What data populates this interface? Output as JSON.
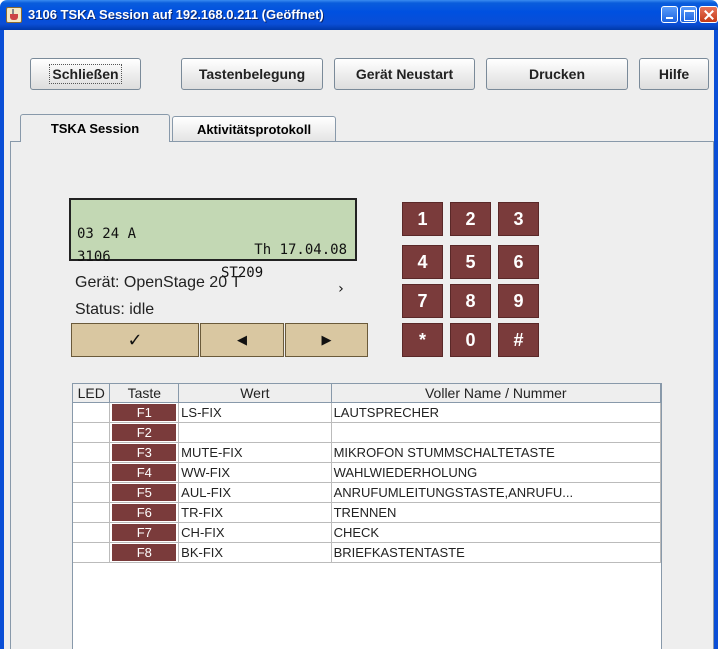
{
  "window": {
    "title": "3106 TSKA Session auf 192.168.0.211 (Geöffnet)"
  },
  "toolbar": {
    "close_label": "Schließen",
    "keymap_label": "Tastenbelegung",
    "restart_label": "Gerät Neustart",
    "print_label": "Drucken",
    "help_label": "Hilfe"
  },
  "tabs": [
    {
      "label": "TSKA Session",
      "active": true
    },
    {
      "label": "Aktivitätsprotokoll",
      "active": false
    }
  ],
  "display": {
    "line1_left": "03 24 A",
    "line1_right": "Th 17.04.08",
    "line2_left": "3106",
    "line2_mid": "ST209",
    "line2_right": "›"
  },
  "device": {
    "model_text": "Gerät: OpenStage 20 T",
    "status_text": "Status: idle"
  },
  "nav": {
    "ok_glyph": "✓",
    "left_glyph": "◀",
    "right_glyph": "▶"
  },
  "keypad": [
    "1",
    "2",
    "3",
    "4",
    "5",
    "6",
    "7",
    "8",
    "9",
    "*",
    "0",
    "#"
  ],
  "table": {
    "headers": [
      "LED",
      "Taste",
      "Wert",
      "Voller Name / Nummer"
    ],
    "rows": [
      {
        "key": "F1",
        "value": "LS-FIX",
        "name": "LAUTSPRECHER"
      },
      {
        "key": "F2",
        "value": "",
        "name": ""
      },
      {
        "key": "F3",
        "value": "MUTE-FIX",
        "name": "MIKROFON STUMMSCHALTETASTE"
      },
      {
        "key": "F4",
        "value": "WW-FIX",
        "name": "WAHLWIEDERHOLUNG"
      },
      {
        "key": "F5",
        "value": "AUL-FIX",
        "name": "ANRUFUMLEITUNGSTASTE,ANRUFU..."
      },
      {
        "key": "F6",
        "value": "TR-FIX",
        "name": "TRENNEN"
      },
      {
        "key": "F7",
        "value": "CH-FIX",
        "name": "CHECK"
      },
      {
        "key": "F8",
        "value": "BK-FIX",
        "name": "BRIEFKASTENTASTE"
      }
    ]
  },
  "colors": {
    "titlebar": "#0050e0",
    "key_brown": "#7a3b3b",
    "lcd_green": "#c3d8b4",
    "nav_tan": "#d9c7a1"
  }
}
